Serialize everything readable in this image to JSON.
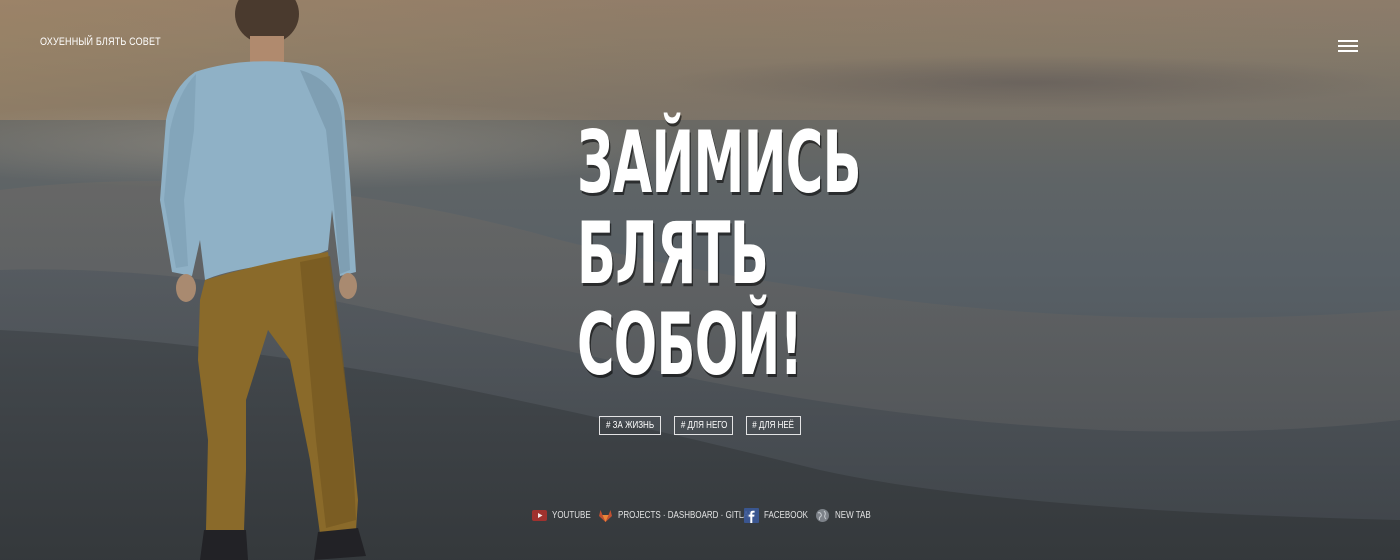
{
  "header": {
    "site_title": "ОХУЕННЫЙ БЛЯТЬ СОВЕТ",
    "menu_icon": "hamburger-menu-icon"
  },
  "hero": {
    "headline_lines": [
      "ЗАЙМИСЬ",
      "БЛЯТЬ",
      "СОБОЙ!"
    ]
  },
  "tags": [
    {
      "label": "# ЗА ЖИЗНЬ"
    },
    {
      "label": "# ДЛЯ НЕГО"
    },
    {
      "label": "# ДЛЯ НЕЁ"
    }
  ],
  "bookmarks": [
    {
      "label": "YOUTUBE",
      "icon": "youtube-icon",
      "color": "#c4302b"
    },
    {
      "label": "PROJECTS · DASHBOARD · GITLAB",
      "icon": "gitlab-icon",
      "color": "#e2432a"
    },
    {
      "label": "FACEBOOK",
      "icon": "facebook-icon",
      "color": "#3b5998"
    },
    {
      "label": "NEW TAB",
      "icon": "globe-icon",
      "color": "#8a8f96"
    }
  ]
}
